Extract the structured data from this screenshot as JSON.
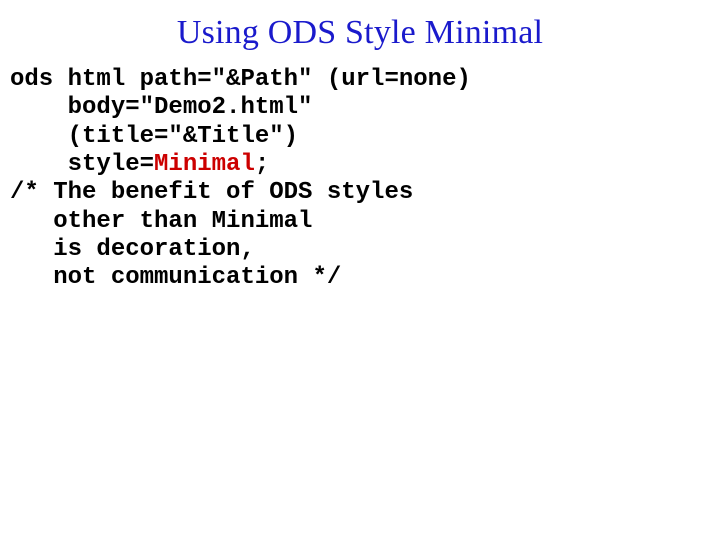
{
  "slide": {
    "title": "Using ODS Style Minimal",
    "code": {
      "line1": "ods html path=\"&Path\" (url=none)",
      "line2": "    body=\"Demo2.html\"",
      "line3": "    (title=\"&Title\")",
      "line4_prefix": "    style=",
      "line4_highlight": "Minimal",
      "line4_suffix": ";",
      "line5": "/* The benefit of ODS styles",
      "line6": "   other than Minimal",
      "line7": "   is decoration,",
      "line8": "   not communication */"
    }
  }
}
